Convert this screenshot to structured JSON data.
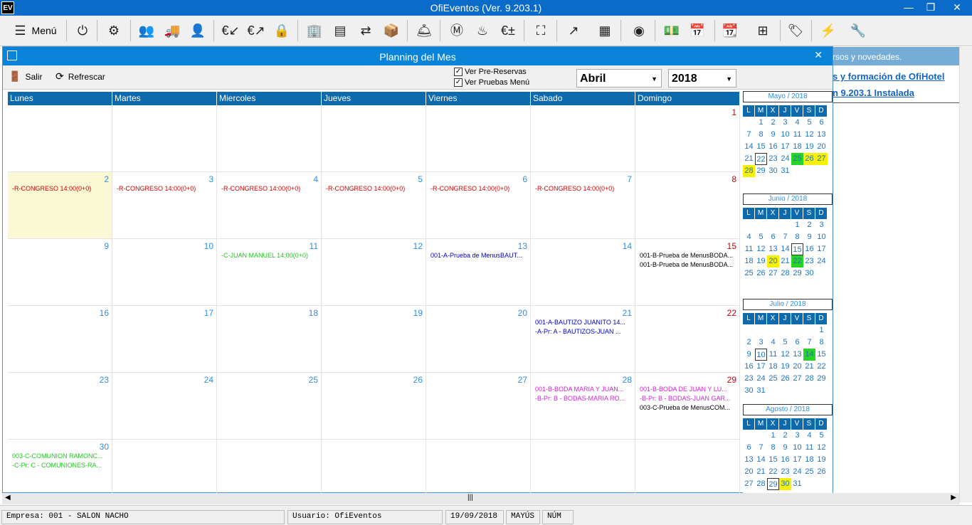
{
  "app": {
    "title": "OfiEventos (Ver. 9.203.1)",
    "icon_label": "EV"
  },
  "toolbar": {
    "menu_label": "Menú"
  },
  "right_panel": {
    "bar_text": "rsos y novedades.",
    "link1": "s y formación de OfiHotel",
    "link2": "n 9.203.1 Instalada"
  },
  "modal": {
    "title": "Planning del Mes",
    "exit_label": "Salir",
    "refresh_label": "Refrescar",
    "chk_prereservas": "Ver Pre-Reservas",
    "chk_pruebas": "Ver Pruebas Menú",
    "month": "Abril",
    "year": "2018"
  },
  "calendar": {
    "weekdays": [
      "Lunes",
      "Martes",
      "Miercoles",
      "Jueves",
      "Viernes",
      "Sabado",
      "Domingo"
    ],
    "weeks": [
      [
        {
          "day": ""
        },
        {
          "day": ""
        },
        {
          "day": ""
        },
        {
          "day": ""
        },
        {
          "day": ""
        },
        {
          "day": ""
        },
        {
          "day": "1",
          "sun": true
        }
      ],
      [
        {
          "day": "2",
          "today": true,
          "events": [
            {
              "text": "-R-CONGRESO 14:00(0+0)",
              "color": "#d00000"
            }
          ]
        },
        {
          "day": "3",
          "events": [
            {
              "text": "-R-CONGRESO 14:00(0+0)",
              "color": "#d00000"
            }
          ]
        },
        {
          "day": "4",
          "events": [
            {
              "text": "-R-CONGRESO 14:00(0+0)",
              "color": "#d00000"
            }
          ]
        },
        {
          "day": "5",
          "events": [
            {
              "text": "-R-CONGRESO 14:00(0+0)",
              "color": "#d00000"
            }
          ]
        },
        {
          "day": "6",
          "events": [
            {
              "text": "-R-CONGRESO 14:00(0+0)",
              "color": "#d00000"
            }
          ]
        },
        {
          "day": "7",
          "events": [
            {
              "text": "-R-CONGRESO 14:00(0+0)",
              "color": "#d00000"
            }
          ]
        },
        {
          "day": "8",
          "sun": true
        }
      ],
      [
        {
          "day": "9"
        },
        {
          "day": "10"
        },
        {
          "day": "11",
          "events": [
            {
              "text": "-C-JUAN MANUEL 14:00(0+0)",
              "color": "#1ec81e"
            }
          ]
        },
        {
          "day": "12"
        },
        {
          "day": "13",
          "events": [
            {
              "text": "001-A-Prueba de MenusBAUT...",
              "color": "#0000c8"
            }
          ]
        },
        {
          "day": "14"
        },
        {
          "day": "15",
          "sun": true,
          "events": [
            {
              "text": "001-B-Prueba de MenusBODA...",
              "color": "#000"
            },
            {
              "text": "001-B-Prueba de MenusBODA...",
              "color": "#000"
            }
          ]
        }
      ],
      [
        {
          "day": "16"
        },
        {
          "day": "17"
        },
        {
          "day": "18"
        },
        {
          "day": "19"
        },
        {
          "day": "20"
        },
        {
          "day": "21",
          "events": [
            {
              "text": "001-A-BAUTIZO JUANITO 14...",
              "color": "#0000c8"
            },
            {
              "text": "-A-Pr: A - BAUTIZOS-JUAN ...",
              "color": "#0000c8"
            }
          ]
        },
        {
          "day": "22",
          "sun": true
        }
      ],
      [
        {
          "day": "23"
        },
        {
          "day": "24"
        },
        {
          "day": "25"
        },
        {
          "day": "26"
        },
        {
          "day": "27"
        },
        {
          "day": "28",
          "events": [
            {
              "text": "001-B-BODA MARIA Y JUAN...",
              "color": "#d41fd4"
            },
            {
              "text": "-B-Pr: B - BODAS-MARIA RO...",
              "color": "#d41fd4"
            }
          ]
        },
        {
          "day": "29",
          "sun": true,
          "events": [
            {
              "text": "001-B-BODA DE JUAN Y LU...",
              "color": "#d41fd4"
            },
            {
              "text": "-B-Pr: B - BODAS-JUAN GAR...",
              "color": "#d41fd4"
            },
            {
              "text": "003-C-Prueba de MenusCOM...",
              "color": "#000"
            }
          ]
        }
      ],
      [
        {
          "day": "30",
          "events": [
            {
              "text": "003-C-COMUNION RAMONC...",
              "color": "#1ec81e"
            },
            {
              "text": "-C-Pr: C - COMUNIONES-RA...",
              "color": "#1ec81e"
            }
          ]
        },
        {
          "day": ""
        },
        {
          "day": ""
        },
        {
          "day": ""
        },
        {
          "day": ""
        },
        {
          "day": ""
        },
        {
          "day": ""
        }
      ]
    ]
  },
  "mini_calendars": {
    "weekdays": [
      "L",
      "M",
      "X",
      "J",
      "V",
      "S",
      "D"
    ],
    "months": [
      {
        "title": "Mayo / 2018",
        "rows": [
          [
            "",
            "1",
            "2",
            "3",
            "4",
            "5",
            "6"
          ],
          [
            "7",
            "8",
            "9",
            "10",
            "11",
            "12",
            "13"
          ],
          [
            "14",
            "15",
            "16",
            "17",
            "18",
            "19",
            "20"
          ],
          [
            "21",
            "22",
            "23",
            "24",
            "25",
            "26",
            "27"
          ],
          [
            "28",
            "29",
            "30",
            "31",
            "",
            "",
            ""
          ]
        ],
        "yellow": [
          "26",
          "27",
          "28"
        ],
        "green": [
          "25"
        ],
        "boxed": [
          "22"
        ]
      },
      {
        "title": "Junio / 2018",
        "rows": [
          [
            "",
            "",
            "",
            "",
            "1",
            "2",
            "3"
          ],
          [
            "4",
            "5",
            "6",
            "7",
            "8",
            "9",
            "10"
          ],
          [
            "11",
            "12",
            "13",
            "14",
            "15",
            "16",
            "17"
          ],
          [
            "18",
            "19",
            "20",
            "21",
            "22",
            "23",
            "24"
          ],
          [
            "25",
            "26",
            "27",
            "28",
            "29",
            "30",
            ""
          ]
        ],
        "yellow": [
          "20"
        ],
        "green": [
          "22"
        ],
        "boxed": [
          "15"
        ]
      },
      {
        "title": "Julio / 2018",
        "rows": [
          [
            "",
            "",
            "",
            "",
            "",
            "",
            "1"
          ],
          [
            "2",
            "3",
            "4",
            "5",
            "6",
            "7",
            "8"
          ],
          [
            "9",
            "10",
            "11",
            "12",
            "13",
            "14",
            "15"
          ],
          [
            "16",
            "17",
            "18",
            "19",
            "20",
            "21",
            "22"
          ],
          [
            "23",
            "24",
            "25",
            "26",
            "27",
            "28",
            "29"
          ],
          [
            "30",
            "31",
            "",
            "",
            "",
            "",
            ""
          ]
        ],
        "yellow": [],
        "green": [
          "14"
        ],
        "boxed": [
          "10"
        ]
      },
      {
        "title": "Agosto / 2018",
        "rows": [
          [
            "",
            "",
            "1",
            "2",
            "3",
            "4",
            "5"
          ],
          [
            "6",
            "7",
            "8",
            "9",
            "10",
            "11",
            "12"
          ],
          [
            "13",
            "14",
            "15",
            "16",
            "17",
            "18",
            "19"
          ],
          [
            "20",
            "21",
            "22",
            "23",
            "24",
            "25",
            "26"
          ],
          [
            "27",
            "28",
            "29",
            "30",
            "31",
            "",
            ""
          ]
        ],
        "yellow": [
          "30"
        ],
        "green": [],
        "boxed": [
          "29"
        ]
      }
    ]
  },
  "status": {
    "empresa": "Empresa: 001 - SALON NACHO",
    "usuario": "Usuario: OfiEventos",
    "fecha": "19/09/2018",
    "mayus": "MAYÚS",
    "num": "NÚM"
  }
}
